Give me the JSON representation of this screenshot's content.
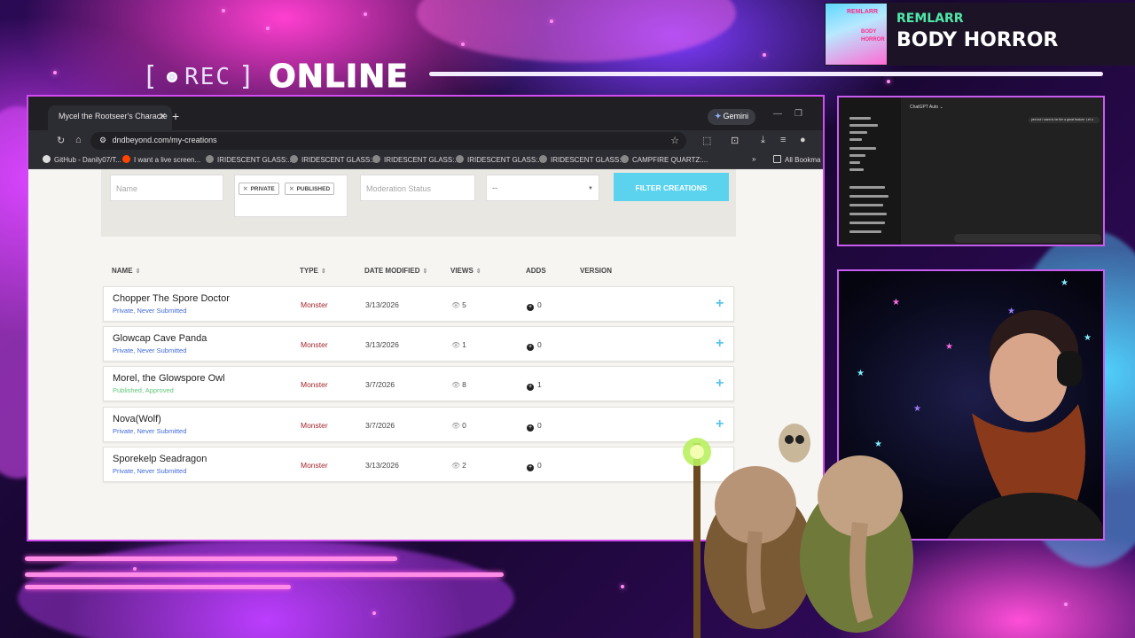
{
  "overlay": {
    "rec_label": "REC",
    "online_label": "ONLINE",
    "now_playing": {
      "artist": "REMLARR",
      "title": "BODY HORROR",
      "art_artist": "REMLARR",
      "art_title": "BODY HORROR"
    }
  },
  "browser": {
    "tab_title": "Mycel the Rootseer's Characte",
    "gemini_label": "Gemini",
    "url": "dndbeyond.com/my-creations",
    "bookmarks": [
      "GitHub - Danily07/T...",
      "I want a live screen...",
      "IRIDESCENT GLASS:...",
      "IRIDESCENT GLASS:...",
      "IRIDESCENT GLASS:...",
      "IRIDESCENT GLASS:...",
      "IRIDESCENT GLASS:...",
      "CAMPFIRE QUARTZ:...",
      "All Bookma"
    ]
  },
  "filters": {
    "name_placeholder": "Name",
    "chips": [
      "PRIVATE",
      "PUBLISHED"
    ],
    "moderation_placeholder": "Moderation Status",
    "select_value": "--",
    "filter_button": "FILTER CREATIONS"
  },
  "table": {
    "headers": {
      "name": "NAME",
      "type": "TYPE",
      "date": "DATE MODIFIED",
      "views": "VIEWS",
      "adds": "ADDS",
      "version": "VERSION"
    },
    "rows": [
      {
        "name": "Chopper The Spore Doctor",
        "status": "Private, Never Submitted",
        "type": "Monster",
        "date": "3/13/2026",
        "views": "5",
        "adds": "0"
      },
      {
        "name": "Glowcap Cave Panda",
        "status": "Private, Never Submitted",
        "type": "Monster",
        "date": "3/13/2026",
        "views": "1",
        "adds": "0"
      },
      {
        "name": "Morel, the Glowspore Owl",
        "status": "Published, Approved",
        "type": "Monster",
        "date": "3/7/2026",
        "views": "8",
        "adds": "1"
      },
      {
        "name": "Nova(Wolf)",
        "status": "Private, Never Submitted",
        "type": "Monster",
        "date": "3/7/2026",
        "views": "0",
        "adds": "0"
      },
      {
        "name": "Sporekelp Seadragon",
        "status": "Private, Never Submitted",
        "type": "Monster",
        "date": "3/13/2026",
        "views": "2",
        "adds": "0"
      }
    ]
  },
  "gpt": {
    "title": "ChatGPT Auto ⌄",
    "message": "yes but I want to be the a great feature. Let u"
  }
}
